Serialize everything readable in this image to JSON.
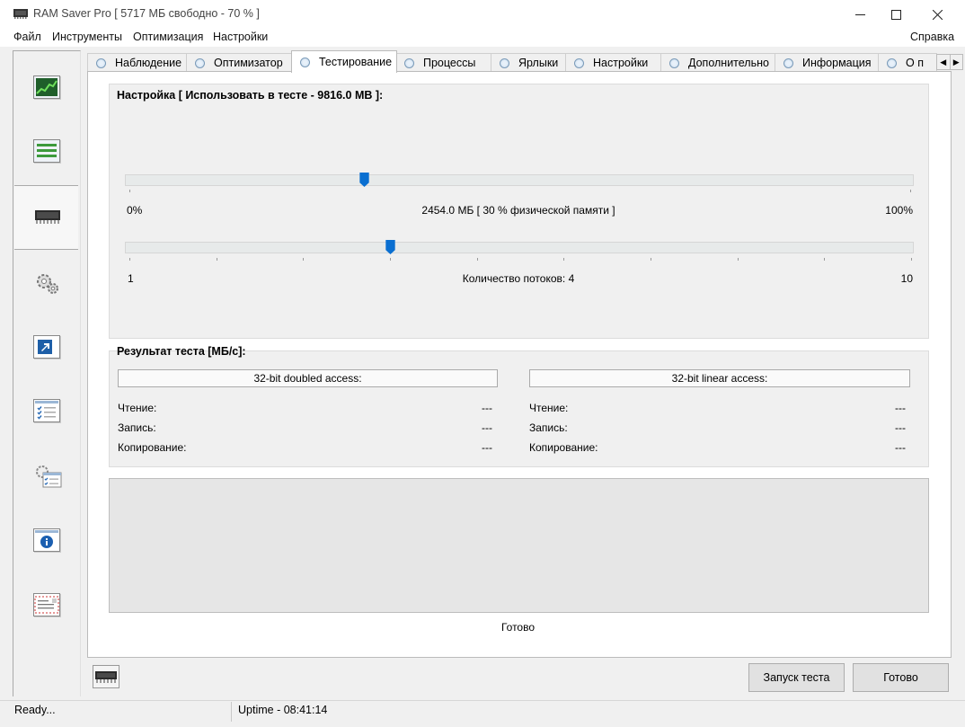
{
  "window": {
    "title": "RAM Saver Pro [ 5717 МБ свободно - 70 % ]"
  },
  "menu": {
    "items": [
      "Файл",
      "Инструменты",
      "Оптимизация",
      "Настройки"
    ],
    "help": "Справка"
  },
  "nav": {
    "icons": [
      "monitor-chart-icon",
      "optimizer-list-icon",
      "memory-chip-icon",
      "gears-icon",
      "shortcut-arrow-icon",
      "checklist-icon",
      "settings-checklist-icon",
      "info-icon",
      "about-letter-icon"
    ],
    "active_index": 2
  },
  "tabs": {
    "items": [
      "Наблюдение",
      "Оптимизатор",
      "Тестирование",
      "Процессы",
      "Ярлыки",
      "Настройки",
      "Дополнительно",
      "Информация",
      "О п"
    ],
    "active_index": 2
  },
  "settings_group": {
    "label": "Настройка [ Использовать в тесте - 9816.0 MB ]:",
    "memory_slider": {
      "min_label": "0%",
      "max_label": "100%",
      "value_label": "2454.0 МБ [ 30 % физической памяти ]",
      "value_percent": 30
    },
    "threads_slider": {
      "min_label": "1",
      "max_label": "10",
      "value_label": "Количество потоков: 4",
      "value": 4,
      "min": 1,
      "max": 10
    }
  },
  "results_group": {
    "label": "Результат теста [МБ/с]:",
    "left": {
      "header": "32-bit doubled access:",
      "rows": [
        {
          "label": "Чтение:",
          "value": "---"
        },
        {
          "label": "Запись:",
          "value": "---"
        },
        {
          "label": "Копирование:",
          "value": "---"
        }
      ]
    },
    "right": {
      "header": "32-bit linear access:",
      "rows": [
        {
          "label": "Чтение:",
          "value": "---"
        },
        {
          "label": "Запись:",
          "value": "---"
        },
        {
          "label": "Копирование:",
          "value": "---"
        }
      ]
    }
  },
  "status_message": "Готово",
  "buttons": {
    "start": "Запуск теста",
    "done": "Готово"
  },
  "statusbar": {
    "state": "Ready...",
    "uptime": "Uptime - 08:41:14"
  },
  "colors": {
    "accent": "#0a6fd1"
  }
}
